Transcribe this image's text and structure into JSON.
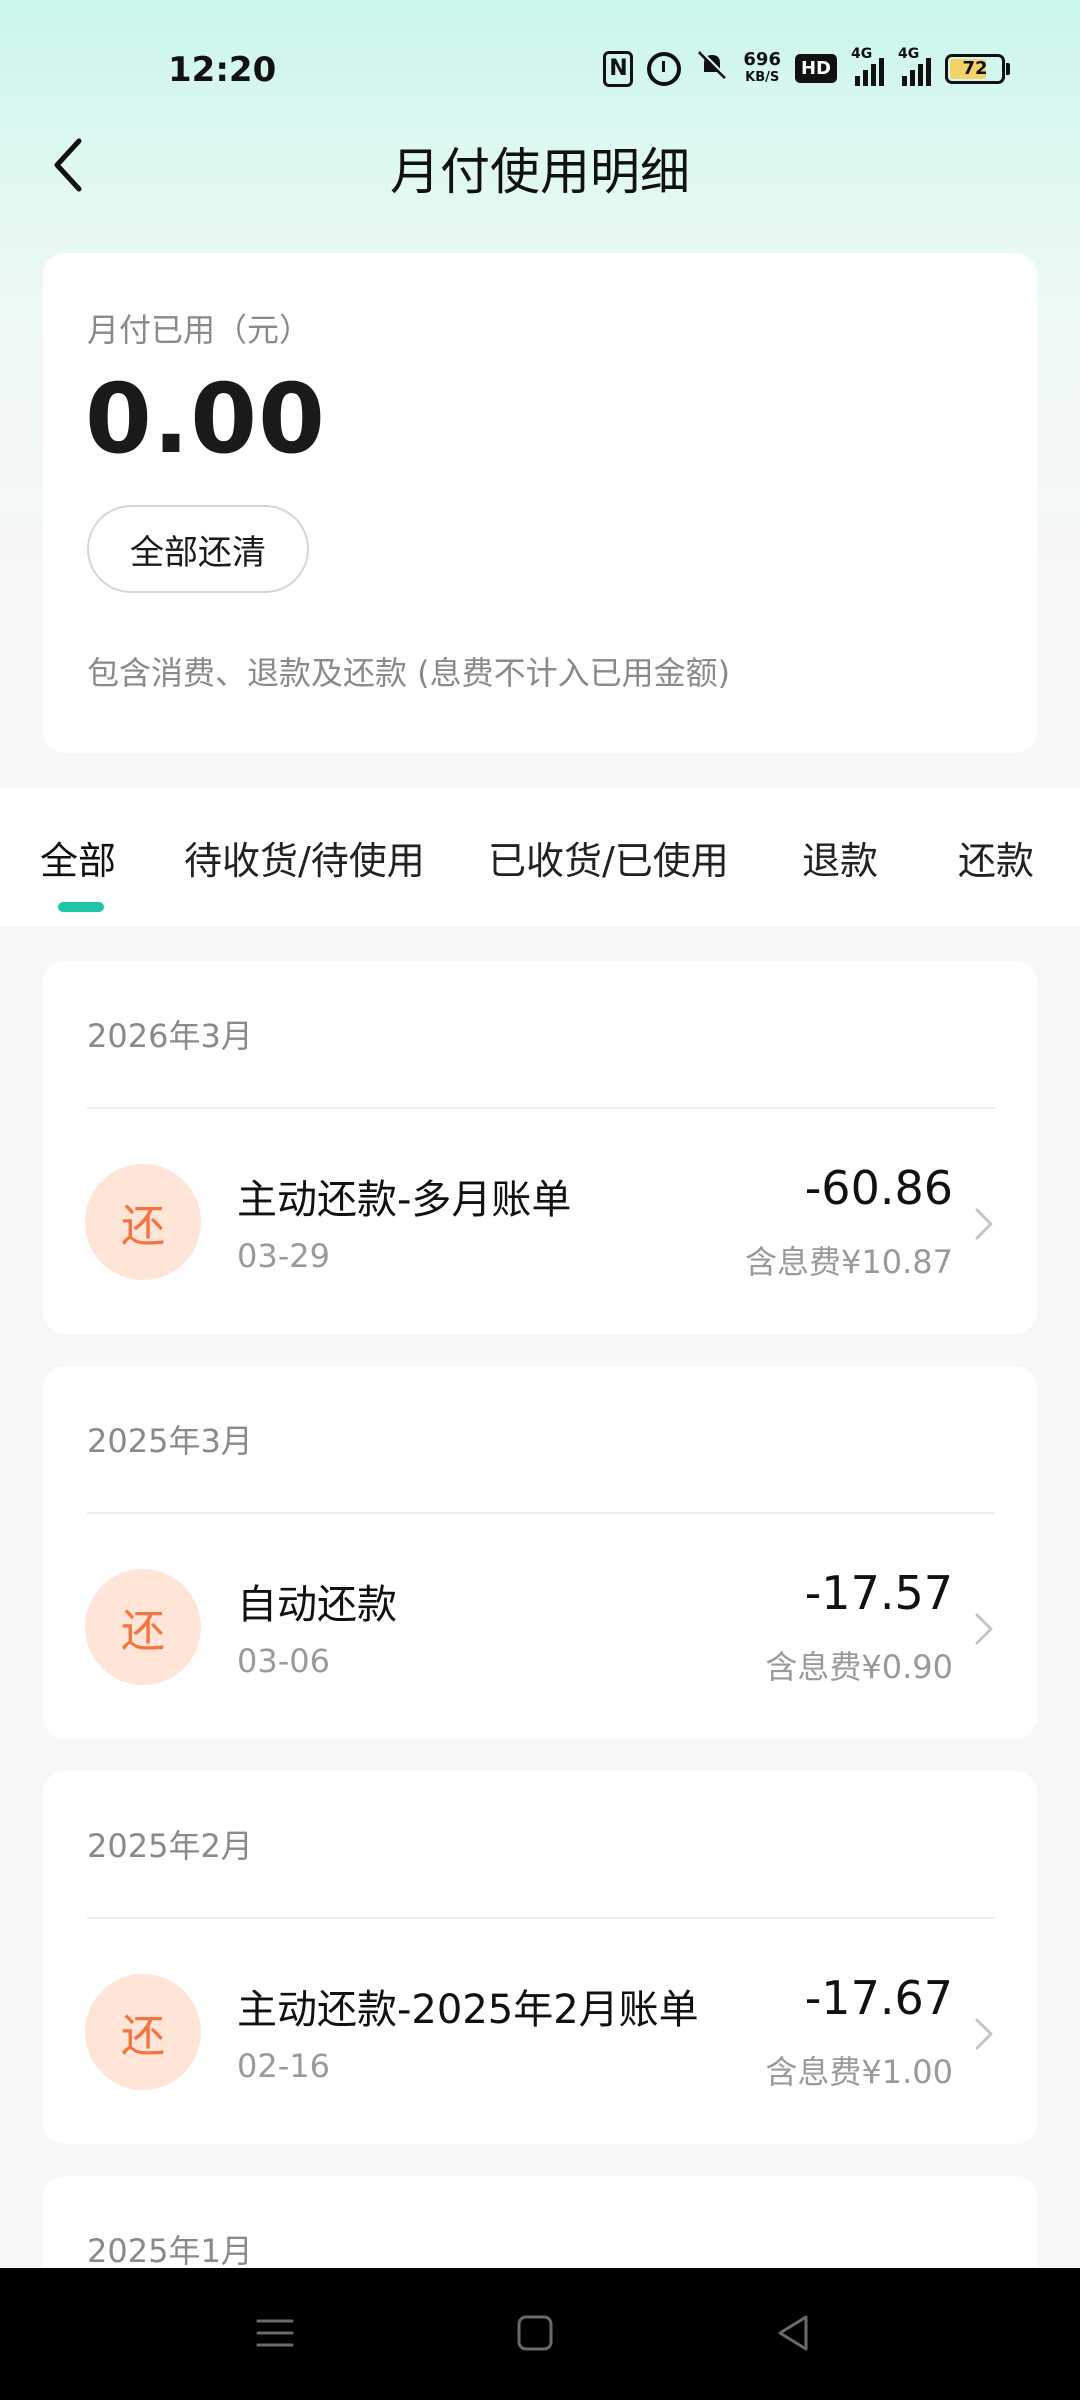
{
  "status_bar": {
    "time": "12:20",
    "nfc_label": "N",
    "speed_value": "696",
    "speed_unit": "KB/S",
    "hd_label": "HD",
    "network_1": "4G",
    "network_2": "4G",
    "battery": "72",
    "battery_level": 0.72,
    "battery_color": "#f1d36a"
  },
  "header": {
    "title": "月付使用明细",
    "back_icon": "chevron-left-icon"
  },
  "summary": {
    "label": "月付已用（元）",
    "amount": "0.00",
    "button": "全部还清",
    "note": "包含消费、退款及还款 (息费不计入已用金额)"
  },
  "tabs": [
    {
      "label": "全部",
      "active": true
    },
    {
      "label": "待收货/待使用",
      "active": false
    },
    {
      "label": "已收货/已使用",
      "active": false
    },
    {
      "label": "退款",
      "active": false
    },
    {
      "label": "还款",
      "active": false
    }
  ],
  "accent_color": "#1fc4a6",
  "months": [
    {
      "month": "2026年3月",
      "items": [
        {
          "icon_text": "还",
          "title": "主动还款-多月账单",
          "date": "03-29",
          "amount": "-60.86",
          "fee": "含息费¥10.87"
        }
      ]
    },
    {
      "month": "2025年3月",
      "items": [
        {
          "icon_text": "还",
          "title": "自动还款",
          "date": "03-06",
          "amount": "-17.57",
          "fee": "含息费¥0.90"
        }
      ]
    },
    {
      "month": "2025年2月",
      "items": [
        {
          "icon_text": "还",
          "title": "主动还款-2025年2月账单",
          "date": "02-16",
          "amount": "-17.67",
          "fee": "含息费¥1.00"
        }
      ]
    },
    {
      "month": "2025年1月",
      "items": []
    }
  ],
  "nav_bar": {
    "menu_icon": "menu-icon",
    "home_icon": "home-icon",
    "back_icon": "back-triangle-icon"
  }
}
